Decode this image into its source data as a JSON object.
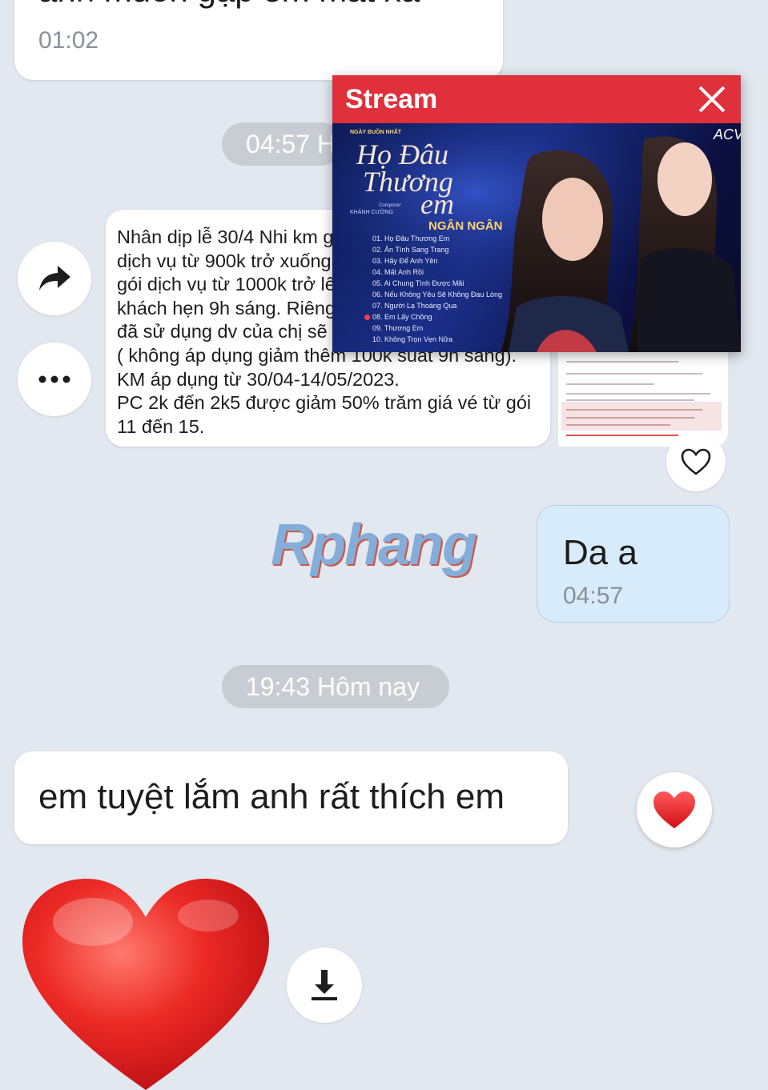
{
  "messages": {
    "first": {
      "text": "anh muốn gặp em mát xa",
      "time": "01:02"
    },
    "date_pill_1": "04:57 H",
    "forwarded": {
      "lines": [
        "Nhân dịp lễ 30/4 Nhi km g",
        "dịch vụ từ 900k trở xuống",
        "gói dịch vụ từ 1000k trở lê",
        "khách hẹn 9h sáng. Riêng",
        "đã sử dụng dv của chị sẽ",
        "( không áp dụng giảm thêm 100k suất 9h sáng).",
        "KM áp dụng từ 30/04-14/05/2023.",
        "PC 2k đến 2k5 được giảm 50% trăm giá vé từ gói",
        "11 đến 15."
      ]
    },
    "reply": {
      "text": "Da a",
      "time": "04:57"
    },
    "date_pill_2": "19:43 Hôm nay",
    "last": {
      "text": "em tuyệt lắm anh rất thích em"
    }
  },
  "watermark": "Rphang",
  "stream_popup": {
    "title": "Stream",
    "album": {
      "tag": "NGÀY BUỒN NHẤT",
      "title_line1": "Họ Đâu",
      "title_line2": "Thương",
      "title_line3": "em",
      "composer_label": "Composer",
      "composer": "KHÁNH CƯỜNG",
      "artist": "NGÂN NGÂN",
      "brand": "ACV",
      "songs": [
        "01. Họ Đâu Thương Em",
        "02. Ân Tình Sang Trang",
        "03. Hãy Để Anh Yên",
        "04. Mất Anh Rồi",
        "05. Ai Chung Tình Được Mãi",
        "06. Nếu Không Yêu Sẽ Không Đau Lòng",
        "07. Người Lạ Thoáng Qua",
        "08. Em Lấy Chồng",
        "09. Thương Em",
        "10. Không Trọn Vẹn Nữa"
      ]
    }
  },
  "colors": {
    "background": "#e2e8ef",
    "reply_bubble": "#d8ebfb",
    "stream_header": "#e0303c",
    "heart": "#e8161e"
  },
  "icons": [
    "forward-icon",
    "more-icon",
    "heart-outline-icon",
    "heart-filled-icon",
    "close-icon",
    "download-icon"
  ]
}
